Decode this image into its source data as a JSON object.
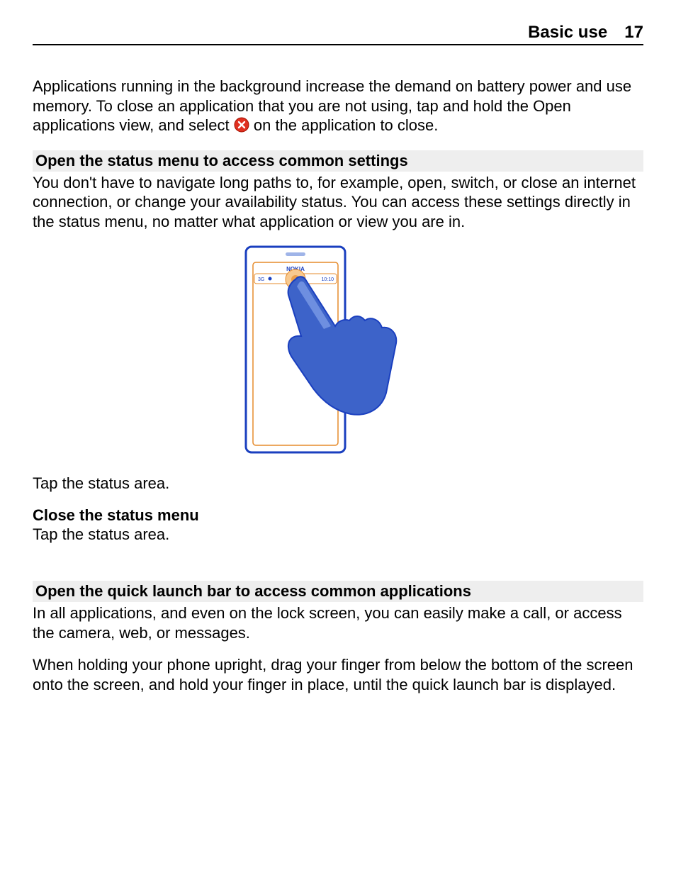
{
  "header": {
    "section": "Basic use",
    "page_number": "17"
  },
  "intro": {
    "para1_a": "Applications running in the background increase the demand on battery power and use memory. To close an application that you are not using, tap and hold the Open applications view, and select ",
    "para1_b": " on the application to close."
  },
  "status_menu": {
    "heading": "Open the status menu to access common settings",
    "para1": "You don't have to navigate long paths to, for example, open, switch, or close an internet connection, or change your availability status. You can access these settings directly in the status menu, no matter what application or view you are in.",
    "figure": {
      "nokia_text": "NOKIA",
      "signal_text": "3G",
      "time_text": "10:10"
    },
    "tap_text": "Tap the status area.",
    "close_heading": "Close the status menu",
    "close_text": "Tap the status area."
  },
  "quick_launch": {
    "heading": "Open the quick launch bar to access common applications",
    "para1": "In all applications, and even on the lock screen, you can easily make a call, or access the camera, web, or messages.",
    "para2": "When holding your phone upright, drag your finger from below the bottom of the screen onto the screen, and hold your finger in place, until the quick launch bar is displayed."
  }
}
